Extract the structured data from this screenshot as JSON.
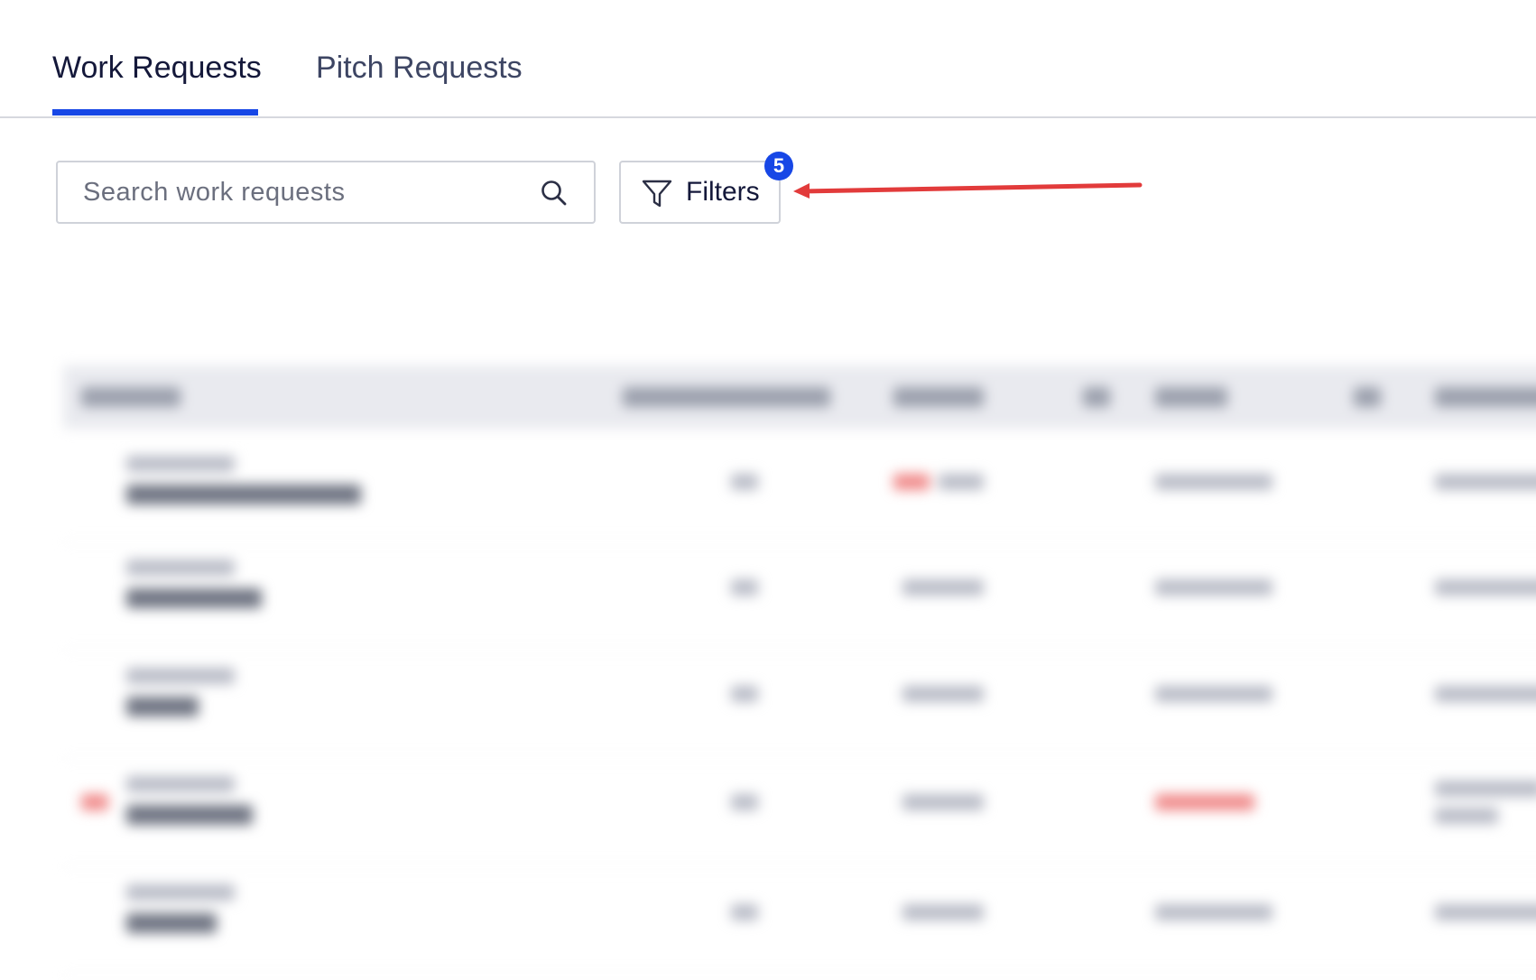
{
  "tabs": [
    {
      "label": "Work Requests",
      "active": true
    },
    {
      "label": "Pitch Requests",
      "active": false
    }
  ],
  "search": {
    "placeholder": "Search work requests",
    "value": ""
  },
  "filters": {
    "label": "Filters",
    "badge_count": "5"
  },
  "icons": {
    "search": "search-icon",
    "filter": "filter-icon",
    "annotation": "red-arrow-annotation"
  },
  "colors": {
    "accent": "#1747e6",
    "annotation": "#e23b3b",
    "text_primary": "#14183a"
  }
}
